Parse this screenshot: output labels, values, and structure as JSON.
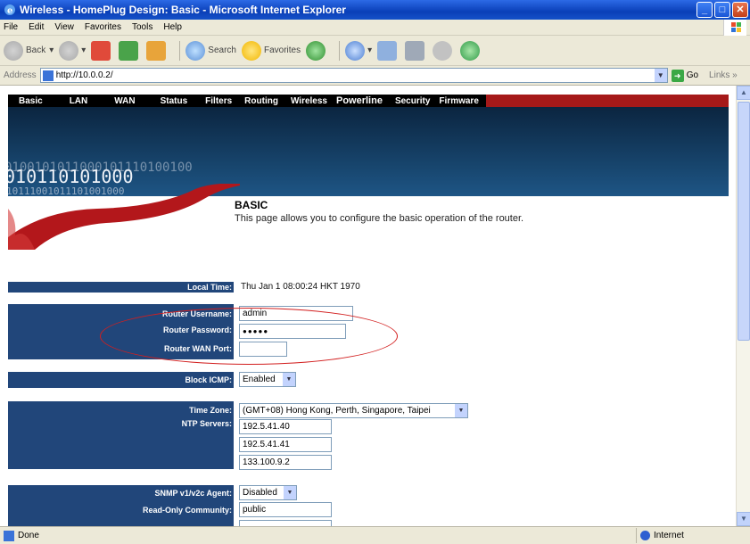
{
  "window": {
    "title": "Wireless - HomePlug Design: Basic - Microsoft Internet Explorer",
    "controls": [
      "minimize",
      "maximize",
      "close"
    ]
  },
  "menu": [
    "File",
    "Edit",
    "View",
    "Favorites",
    "Tools",
    "Help"
  ],
  "toolbar": {
    "back": "Back",
    "search": "Search",
    "favorites": "Favorites"
  },
  "address": {
    "label": "Address",
    "url": "http://10.0.0.2/",
    "go": "Go",
    "links": "Links"
  },
  "nav": [
    "Basic",
    "LAN",
    "WAN",
    "Status",
    "Filters",
    "Routing",
    "Wireless",
    "Powerline",
    "Security",
    "Firmware"
  ],
  "banner": {
    "binary_row1": "0100101011000101110100100",
    "binary_row2": "010110101000",
    "binary_row3": "10111001011101001000",
    "binary_row4": "11101010000"
  },
  "page": {
    "title": "BASIC",
    "description": "This page allows you to configure the basic operation of the router."
  },
  "form": {
    "local_time_label": "Local Time:",
    "local_time_value": "Thu Jan 1 08:00:24 HKT 1970",
    "username_label": "Router Username:",
    "username_value": "admin",
    "password_label": "Router Password:",
    "password_value": "●●●●●",
    "wan_port_label": "Router WAN Port:",
    "wan_port_value": "",
    "block_icmp_label": "Block ICMP:",
    "block_icmp_value": "Enabled",
    "timezone_label": "Time Zone:",
    "timezone_value": "(GMT+08) Hong Kong, Perth, Singapore, Taipei",
    "ntp_label": "NTP Servers:",
    "ntp_servers": [
      "192.5.41.40",
      "192.5.41.41",
      "133.100.9.2"
    ],
    "snmp_label": "SNMP v1/v2c Agent:",
    "snmp_value": "Disabled",
    "readonly_label": "Read-Only Community:",
    "readonly_value": "public"
  },
  "status": {
    "left": "Done",
    "zone": "Internet"
  },
  "colors": {
    "nav_bg": "#000000",
    "label_bar": "#21467a",
    "highlight_oval": "#d21f1f",
    "title_bar": "#0a3fb8"
  }
}
